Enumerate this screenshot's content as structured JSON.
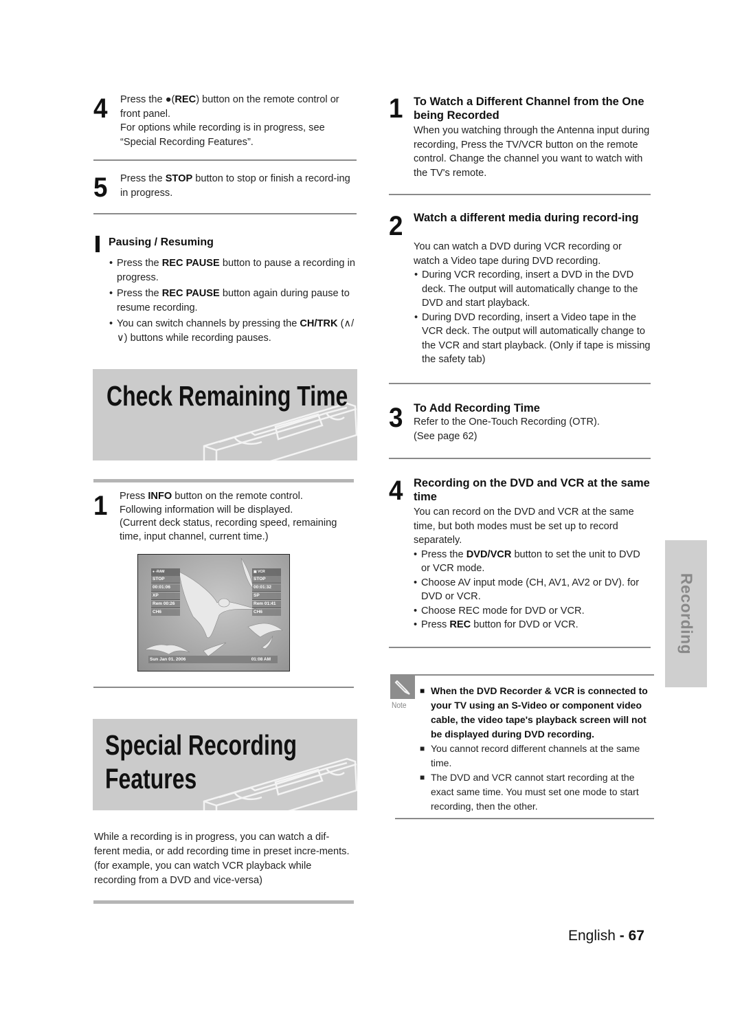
{
  "left_column": {
    "step4": {
      "number": "4",
      "line1_pre": "Press the ●(",
      "line1_bold": "REC",
      "line1_post": ") button on the remote control or front panel.",
      "line2": "For options while recording is in progress, see “Special Recording Features”."
    },
    "step5": {
      "number": "5",
      "pre": "Press the ",
      "bold": "STOP",
      "post": " button to stop or finish a record-ing in progress."
    },
    "pausing": {
      "heading": "Pausing / Resuming",
      "bullets": [
        {
          "pre": "Press the ",
          "bold": "REC PAUSE",
          "post": " button to pause a recording in progress."
        },
        {
          "pre": "Press the ",
          "bold": "REC PAUSE",
          "post": " button again during pause to resume recording."
        },
        {
          "pre": "You can switch channels by pressing the ",
          "bold": "CH/TRK",
          "post": " (∧/∨) buttons while recording pauses."
        }
      ]
    },
    "check_banner": {
      "title": "Check Remaining Time"
    },
    "check_step1": {
      "number": "1",
      "pre": "Press ",
      "bold": "INFO",
      "post": " button on the remote control.",
      "line2": "Following information will be displayed.",
      "line3": "(Current deck status, recording speed, remaining time, input channel, current time.)"
    },
    "osd": {
      "dvd": {
        "label": "-RAM",
        "status": "STOP",
        "time": "00:01:06",
        "speed": "XP",
        "remaining": "Rem 00:26",
        "channel": "CH6"
      },
      "vcr": {
        "label": "VCR",
        "status": "STOP",
        "time": "00:01:32",
        "speed": "SP",
        "remaining": "Rem 01:41",
        "channel": "CH6"
      },
      "date": "Sun Jan 01. 2006",
      "clock": "01:08 AM"
    },
    "special_banner": {
      "title_line1": "Special Recording",
      "title_line2": "Features"
    },
    "intro": "While a recording is in progress, you can watch a dif-ferent media, or add recording time in preset incre-ments. (for example, you can watch VCR playback while recording from a DVD and vice-versa)"
  },
  "right_column": {
    "step1": {
      "number": "1",
      "heading": "To Watch a Different Channel from the One being Recorded",
      "body": "When you watching through the Antenna input during recording, Press the TV/VCR button on the remote control. Change the channel you want to watch with the TV's remote."
    },
    "step2": {
      "number": "2",
      "heading": "Watch a different media during record-ing",
      "body": "You can watch a DVD during VCR recording or watch a Video tape during DVD recording.",
      "bullets": [
        "During VCR recording, insert a DVD in the DVD deck. The output will automatically change to the DVD and start playback.",
        "During DVD recording, insert a Video tape in the VCR deck. The output will automatically change to the VCR and start playback. (Only if tape is missing the safety tab)"
      ]
    },
    "step3": {
      "number": "3",
      "heading": "To Add Recording Time",
      "body1": "Refer to the One-Touch Recording (OTR).",
      "body2": "(See page 62)"
    },
    "step4": {
      "number": "4",
      "heading": "Recording on the DVD and VCR at the same time",
      "body": "You can record on the DVD and VCR at the same time, but both modes must be set up to record separately.",
      "bullets": [
        {
          "pre": "Press the ",
          "bold": "DVD/VCR",
          "post": " button to set the unit to DVD or VCR mode."
        },
        {
          "pre": "Choose AV input mode (CH, AV1, AV2 or DV). for DVD or VCR.",
          "bold": "",
          "post": ""
        },
        {
          "pre": "Choose REC mode for DVD or VCR.",
          "bold": "",
          "post": ""
        },
        {
          "pre": "Press ",
          "bold": "REC",
          "post": " button for DVD or VCR."
        }
      ]
    },
    "note": {
      "icon": "pencil-icon",
      "label": "Note",
      "items": [
        "When the DVD Recorder & VCR is connected to your TV using an S-Video or component video cable, the video tape's playback screen will not be displayed during DVD recording.",
        "You cannot record different channels at the same time.",
        "The DVD and VCR cannot start recording at the exact same time. You must set one mode to start recording, then the other."
      ]
    }
  },
  "side_tab": {
    "label": "Recording"
  },
  "footer": {
    "language": "English",
    "separator": " - ",
    "page": "67"
  }
}
